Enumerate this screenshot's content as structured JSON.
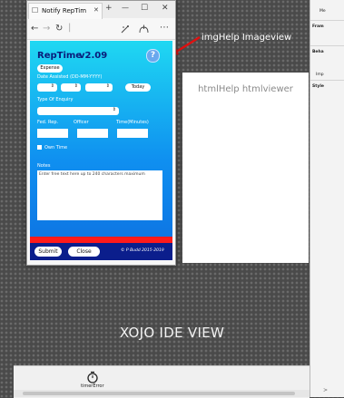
{
  "browser": {
    "tab_title": "Notify RepTim",
    "tab_close_glyph": "✕",
    "new_tab_glyph": "+",
    "minimize_glyph": "—",
    "maximize_glyph": "☐",
    "close_glyph": "✕",
    "back_glyph": "←",
    "forward_glyph": "→",
    "refresh_glyph": "↻",
    "more_glyph": "⋯"
  },
  "app": {
    "title": "RepTime",
    "version": "v2.09",
    "expense_label": "Expense",
    "date_label": "Date Assisted (DD-MM-YYYY)",
    "today_label": "Today",
    "enquiry_label": "Type Of Enquiry",
    "fed_rep_label": "Fed. Rep.",
    "officer_label": "Officer",
    "time_label": "Time(Minutes)",
    "own_time_label": "Own Time",
    "notes_label": "Notes",
    "notes_placeholder": "Enter free text here up to 240 characters maximum",
    "submit_label": "Submit",
    "close_label": "Close",
    "copyright": "© P Budd 2015-2019",
    "help_glyph": "?",
    "colors": {
      "gradient_top": "#1fd8f2",
      "gradient_bottom": "#0d6fe0",
      "red_bar": "#ff1a1a",
      "bottom_bar": "#0b1e8c"
    }
  },
  "ide": {
    "img_help_label": "imgHelp Imageview",
    "html_help_label": "htmlHelp htmlviewer",
    "view_label": "XOJO IDE  VIEW",
    "timer_label": "timerError"
  },
  "inspector": {
    "row1": "Me",
    "row2": "Fram",
    "row3": "Beha",
    "row4": "Imp",
    "row5": "Style",
    "scroll_glyph": ">"
  }
}
